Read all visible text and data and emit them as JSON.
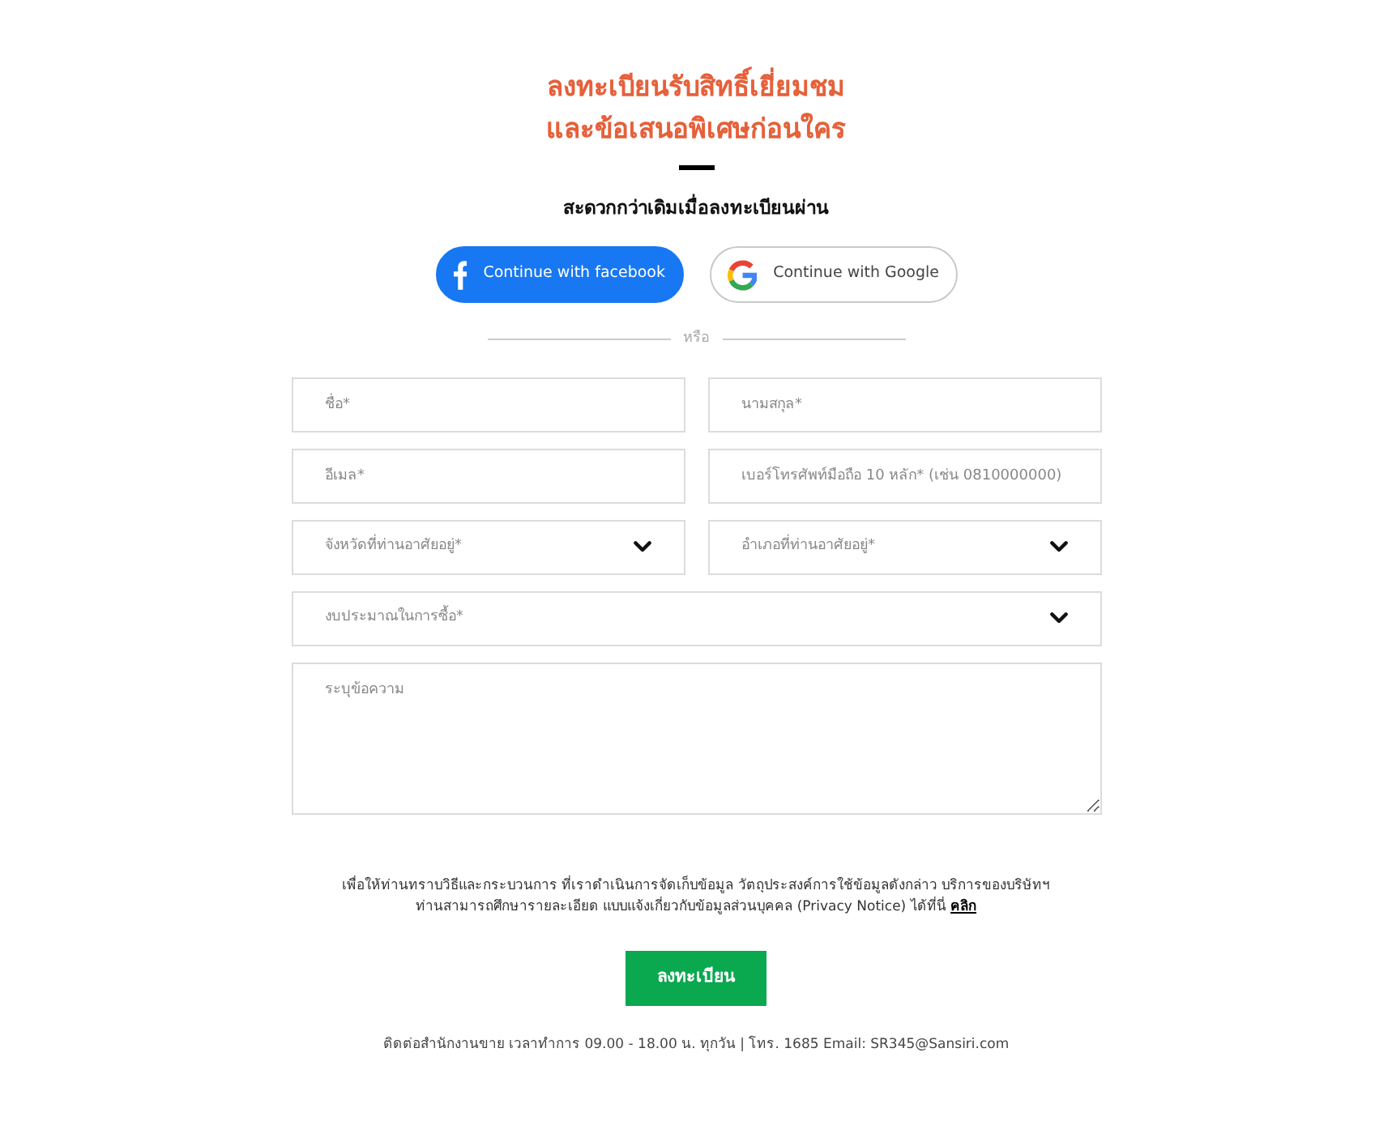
{
  "header": {
    "title_lines": [
      "ลงทะเบียนรับสิทธิ์เยี่ยมชม",
      "และข้อเสนอพิเศษก่อนใคร"
    ],
    "subtitle": "สะดวกกว่าเดิมเมื่อลงทะเบียนผ่าน"
  },
  "social_buttons": [
    {
      "kind": "facebook",
      "label": "Continue with facebook"
    },
    {
      "kind": "google",
      "label": "Continue with Google"
    }
  ],
  "divider": {
    "label": "หรือ"
  },
  "form": {
    "rows": [
      [
        {
          "kind": "text",
          "placeholder": "ชื่อ*"
        },
        {
          "kind": "text",
          "placeholder": "นามสกุล*"
        }
      ],
      [
        {
          "kind": "text",
          "placeholder": "อีเมล*"
        },
        {
          "kind": "text",
          "placeholder": "เบอร์โทรศัพท์มือถือ 10 หลัก* (เช่น 0810000000)"
        }
      ],
      [
        {
          "kind": "select",
          "placeholder": "จังหวัดที่ท่านอาศัยอยู่*"
        },
        {
          "kind": "select",
          "placeholder": "อำเภอที่ท่านอาศัยอยู่*"
        }
      ],
      [
        {
          "kind": "select",
          "placeholder": "งบประมาณในการซื้อ*"
        }
      ],
      [
        {
          "kind": "textarea",
          "placeholder": "ระบุข้อความ"
        }
      ]
    ]
  },
  "privacy_notice": {
    "lines": [
      "เพื่อให้ท่านทราบวิธีและกระบวนการ ที่เราดำเนินการจัดเก็บข้อมูล วัตถุประสงค์การใช้ข้อมูลดังกล่าว บริการของบริษัทฯ",
      "ท่านสามารถศึกษารายละเอียด แบบแจ้งเกี่ยวกับข้อมูลส่วนบุคคล (Privacy Notice) ได้ที่นี่"
    ],
    "link": "คลิก"
  },
  "submit_button": {
    "label": "ลงทะเบียน"
  },
  "footer": "ติดต่อสำนักงานขาย เวลาทำการ 09.00 - 18.00 น. ทุกวัน | โทร. 1685 Email: SR345@Sansiri.com"
}
